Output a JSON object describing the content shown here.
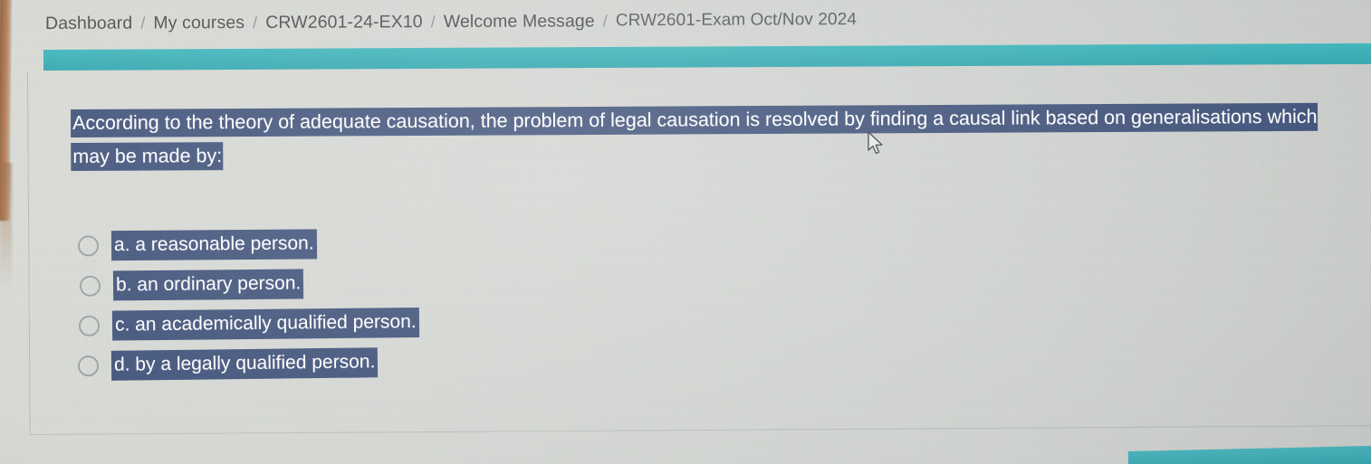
{
  "breadcrumb": {
    "separator": "/",
    "items": [
      {
        "label": "Dashboard"
      },
      {
        "label": "My courses"
      },
      {
        "label": "CRW2601-24-EX10"
      },
      {
        "label": "Welcome Message"
      },
      {
        "label": "CRW2601-Exam Oct/Nov 2024"
      }
    ]
  },
  "quiz": {
    "question_line1": "According to the theory of adequate causation, the problem of legal causation is resolved by finding a causal link based on generalisations which",
    "question_line2": "may be made by:",
    "options": [
      {
        "label": "a. a reasonable person.",
        "selected": false
      },
      {
        "label": "b. an ordinary person.",
        "selected": false
      },
      {
        "label": "c. an academically qualified person.",
        "selected": false
      },
      {
        "label": "d. by a legally qualified person.",
        "selected": false
      }
    ]
  },
  "colors": {
    "highlight_selection": "#3c4f78",
    "banner_teal": "#35aeb6",
    "page_background": "#d4d7d3",
    "breadcrumb_text": "#4a4d4c"
  },
  "cursor": {
    "type": "arrow-pointer"
  }
}
